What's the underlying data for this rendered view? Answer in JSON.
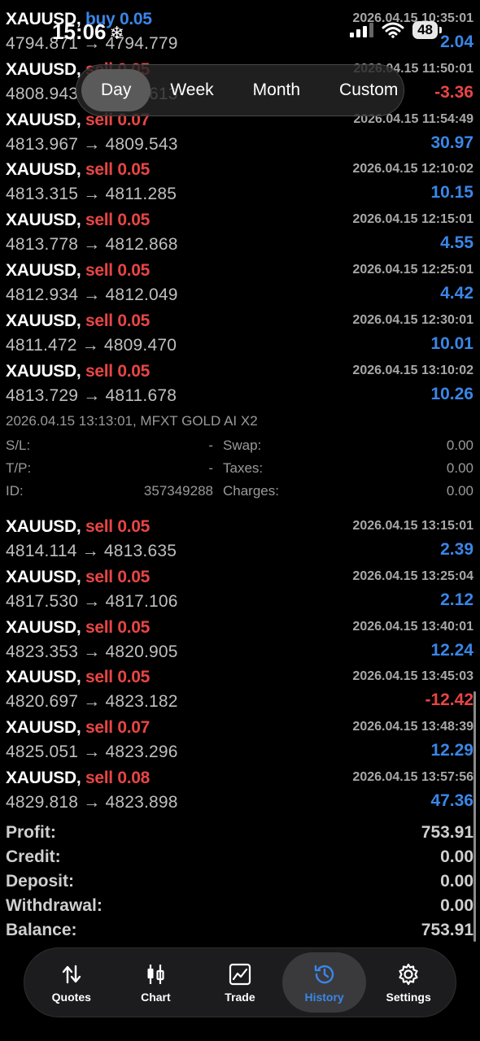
{
  "status_bar": {
    "time": "15:06",
    "time_icon": "❄",
    "battery": "48"
  },
  "periods": [
    "Day",
    "Week",
    "Month",
    "Custom"
  ],
  "active_period": "Day",
  "trades": [
    {
      "symbol": "XAUUSD,",
      "side": "buy 0.05",
      "prices": "4794.871 → 4794.779",
      "time": "2026.04.15 10:35:01",
      "profit": "2.04"
    },
    {
      "symbol": "XAUUSD,",
      "side": "sell 0.05",
      "prices": "4808.943 → 4809.613",
      "time": "2026.04.15 11:50:01",
      "profit": "-3.36"
    },
    {
      "symbol": "XAUUSD,",
      "side": "sell 0.07",
      "prices": "4813.967 → 4809.543",
      "time": "2026.04.15 11:54:49",
      "profit": "30.97"
    },
    {
      "symbol": "XAUUSD,",
      "side": "sell 0.05",
      "prices": "4813.315 → 4811.285",
      "time": "2026.04.15 12:10:02",
      "profit": "10.15"
    },
    {
      "symbol": "XAUUSD,",
      "side": "sell 0.05",
      "prices": "4813.778 → 4812.868",
      "time": "2026.04.15 12:15:01",
      "profit": "4.55"
    },
    {
      "symbol": "XAUUSD,",
      "side": "sell 0.05",
      "prices": "4812.934 → 4812.049",
      "time": "2026.04.15 12:25:01",
      "profit": "4.42"
    },
    {
      "symbol": "XAUUSD,",
      "side": "sell 0.05",
      "prices": "4811.472 → 4809.470",
      "time": "2026.04.15 12:30:01",
      "profit": "10.01"
    },
    {
      "symbol": "XAUUSD,",
      "side": "sell 0.05",
      "prices": "4813.729 → 4811.678",
      "time": "2026.04.15 13:10:02",
      "profit": "10.26"
    }
  ],
  "detail": {
    "header": "2026.04.15 13:13:01, MFXT GOLD AI X2",
    "sl_label": "S/L:",
    "sl_value": "-",
    "tp_label": "T/P:",
    "tp_value": "-",
    "id_label": "ID:",
    "id_value": "357349288",
    "swap_label": "Swap:",
    "swap_value": "0.00",
    "taxes_label": "Taxes:",
    "taxes_value": "0.00",
    "charges_label": "Charges:",
    "charges_value": "0.00"
  },
  "trades2": [
    {
      "symbol": "XAUUSD,",
      "side": "sell 0.05",
      "prices": "4814.114 → 4813.635",
      "time": "2026.04.15 13:15:01",
      "profit": "2.39"
    },
    {
      "symbol": "XAUUSD,",
      "side": "sell 0.05",
      "prices": "4817.530 → 4817.106",
      "time": "2026.04.15 13:25:04",
      "profit": "2.12"
    },
    {
      "symbol": "XAUUSD,",
      "side": "sell 0.05",
      "prices": "4823.353 → 4820.905",
      "time": "2026.04.15 13:40:01",
      "profit": "12.24"
    },
    {
      "symbol": "XAUUSD,",
      "side": "sell 0.05",
      "prices": "4820.697 → 4823.182",
      "time": "2026.04.15 13:45:03",
      "profit": "-12.42"
    },
    {
      "symbol": "XAUUSD,",
      "side": "sell 0.07",
      "prices": "4825.051 → 4823.296",
      "time": "2026.04.15 13:48:39",
      "profit": "12.29"
    },
    {
      "symbol": "XAUUSD,",
      "side": "sell 0.08",
      "prices": "4829.818 → 4823.898",
      "time": "2026.04.15 13:57:56",
      "profit": "47.36"
    }
  ],
  "summary": [
    {
      "label": "Profit:",
      "value": "753.91"
    },
    {
      "label": "Credit:",
      "value": "0.00"
    },
    {
      "label": "Deposit:",
      "value": "0.00"
    },
    {
      "label": "Withdrawal:",
      "value": "0.00"
    },
    {
      "label": "Balance:",
      "value": "753.91"
    }
  ],
  "tabs": [
    {
      "label": "Quotes",
      "icon": "quotes-arrows-icon"
    },
    {
      "label": "Chart",
      "icon": "candlestick-icon"
    },
    {
      "label": "Trade",
      "icon": "trade-chart-icon"
    },
    {
      "label": "History",
      "icon": "history-clock-icon"
    },
    {
      "label": "Settings",
      "icon": "gear-icon"
    }
  ],
  "active_tab": "History",
  "colors": {
    "sell": "#e84545",
    "buy": "#3a86e8",
    "profit_positive": "#3a86e8",
    "profit_negative": "#e84545",
    "background": "#000000"
  }
}
